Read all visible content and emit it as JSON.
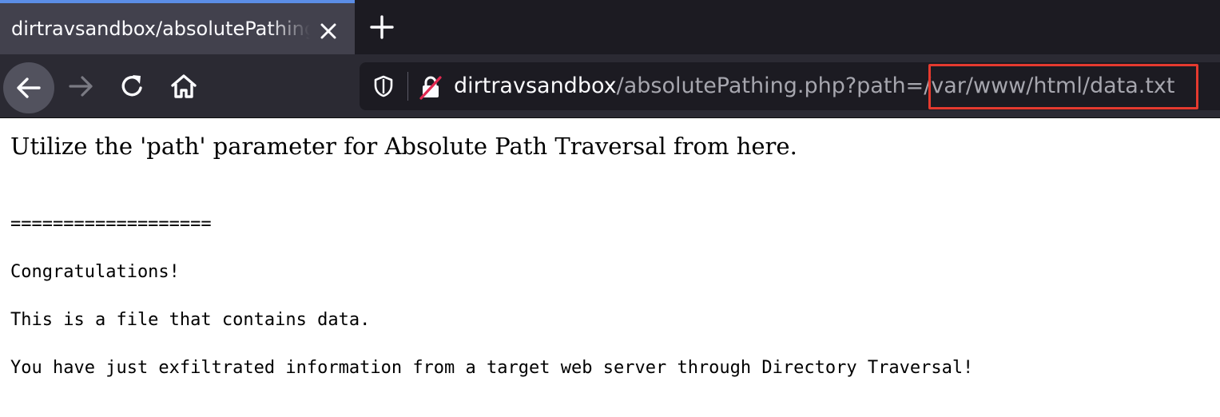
{
  "tab": {
    "title": "dirtravsandbox/absolutePathing.php?path=/var/www/html/data.txt"
  },
  "urlbar": {
    "host": "dirtravsandbox",
    "path_prefix": "/absolutePathing.php?path=",
    "path_value": "/var/www/html/data.txt",
    "highlight_color": "#e53a2f"
  },
  "icons": {
    "tab_close": "close-icon",
    "new_tab": "plus-icon",
    "back": "arrow-left-icon",
    "forward": "arrow-right-icon",
    "reload": "reload-icon",
    "home": "home-icon",
    "tracking_protection": "shield-icon",
    "connection": "insecure-lock-icon"
  },
  "page": {
    "heading": "Utilize the 'path' parameter for Absolute Path Traversal from here.",
    "separator": "===================",
    "lines": [
      "Congratulations!",
      "This is a file that contains data.",
      "You have just exfiltrated information from a target web server through Directory Traversal!"
    ]
  },
  "colors": {
    "tab_active": "#42414d",
    "toolbar": "#2b2a33",
    "urlbar_bg": "#1c1b22",
    "tab_accent": "#5b8de6"
  }
}
